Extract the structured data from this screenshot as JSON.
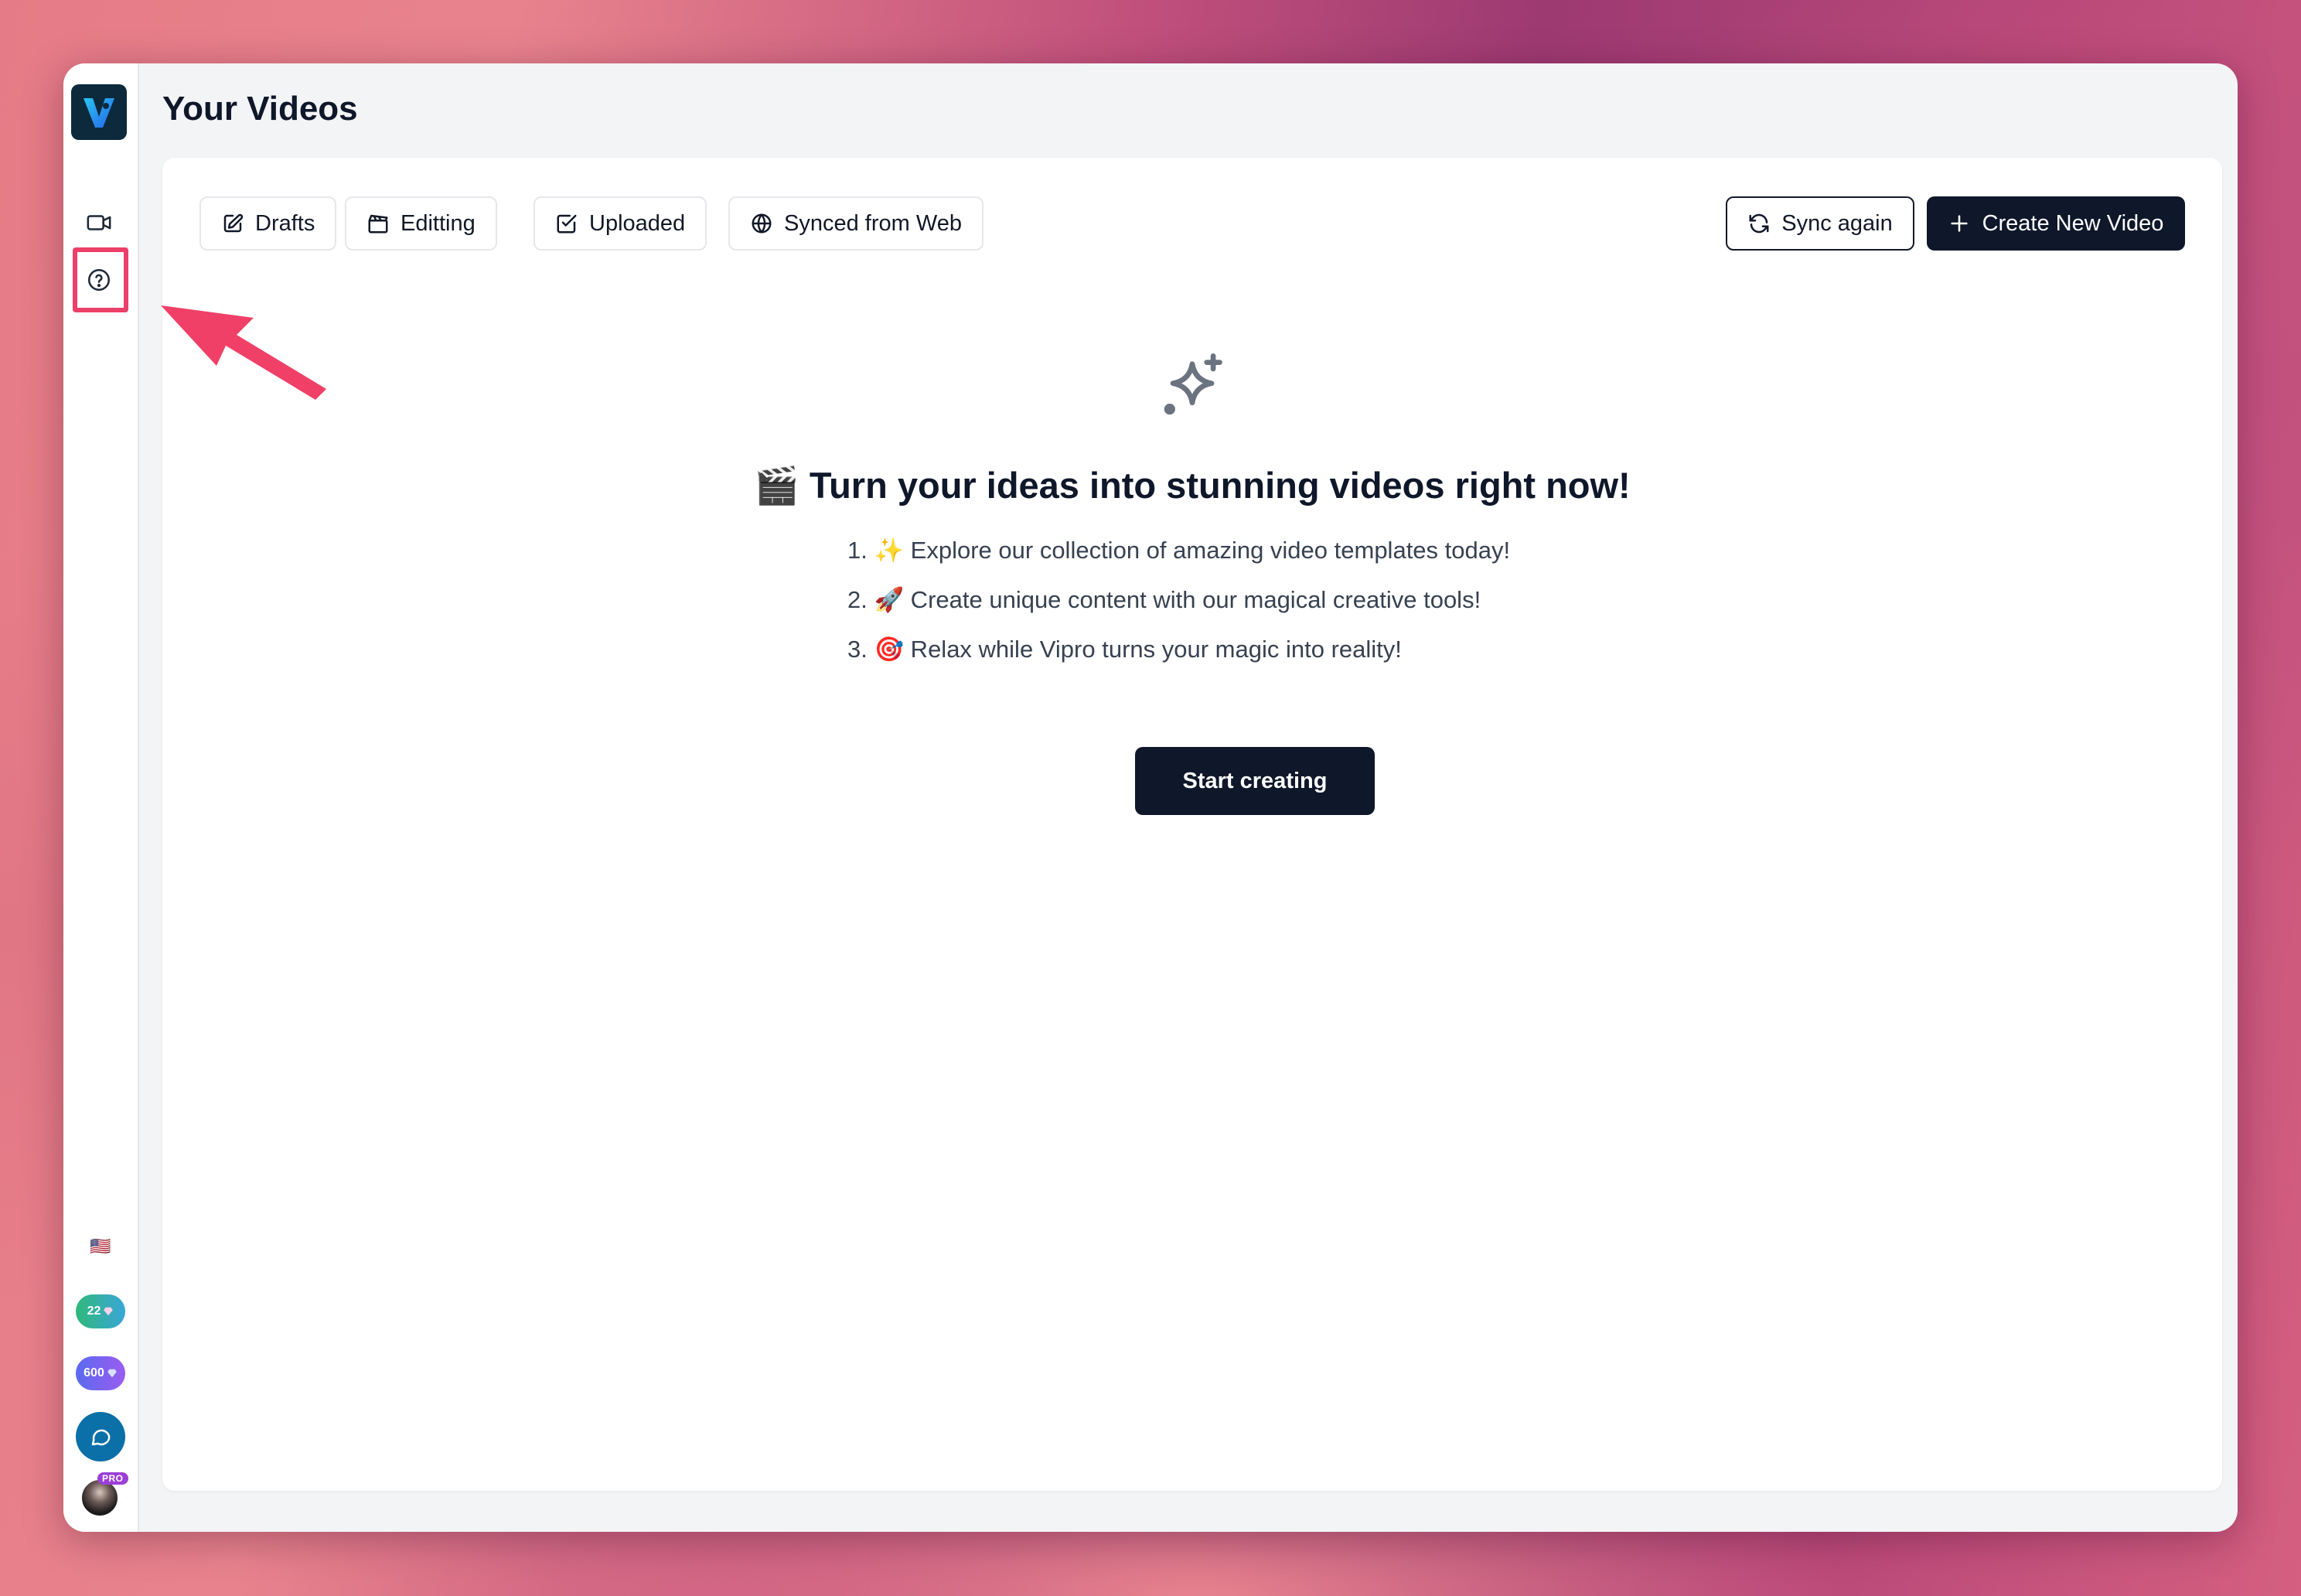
{
  "page": {
    "title": "Your Videos"
  },
  "sidebar": {
    "logo_letter": "V",
    "items": [
      {
        "name": "videos",
        "icon": "video-camera-icon"
      },
      {
        "name": "help",
        "icon": "help-circle-icon"
      }
    ],
    "flag": "🇺🇸",
    "credits_green": {
      "value": "22",
      "icon": "gem-icon"
    },
    "credits_purple": {
      "value": "600",
      "icon": "gem-icon"
    },
    "chat_icon": "chat-bubble-icon",
    "avatar_badge": "PRO"
  },
  "tabs": [
    {
      "label": "Drafts",
      "icon": "edit-icon"
    },
    {
      "label": "Editting",
      "icon": "clapperboard-icon"
    },
    {
      "label": "Uploaded",
      "icon": "check-square-icon"
    },
    {
      "label": "Synced from Web",
      "icon": "globe-icon"
    }
  ],
  "actions": {
    "sync_label": "Sync again",
    "create_label": "Create New Video"
  },
  "empty_state": {
    "icon": "sparkles-icon",
    "headline": "🎬 Turn your ideas into stunning videos right now!",
    "steps": [
      "1. ✨ Explore our collection of amazing video templates today!",
      "2. 🚀 Create unique content with our magical creative tools!",
      "3. 🎯 Relax while Vipro turns your magic into reality!"
    ],
    "cta_label": "Start creating"
  },
  "colors": {
    "accent_dark": "#0f172a",
    "highlight": "#ec3f6a",
    "chat_blue": "#0b6fa8"
  }
}
